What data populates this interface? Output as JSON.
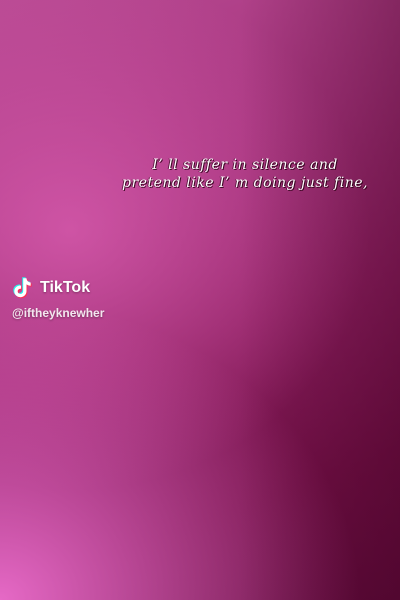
{
  "lyrics": {
    "line1": "I’ ll suffer in silence and",
    "line2": "pretend like I’ m doing just fine,"
  },
  "watermark": {
    "brand": "TikTok",
    "handle": "@iftheyknewher",
    "icon": "tiktok-logo-icon"
  },
  "colors": {
    "background_top_right": "#5d0a39",
    "background_mid": "#a3337b",
    "background_bottom_left": "#ec6ecd",
    "text": "#ffffff"
  }
}
